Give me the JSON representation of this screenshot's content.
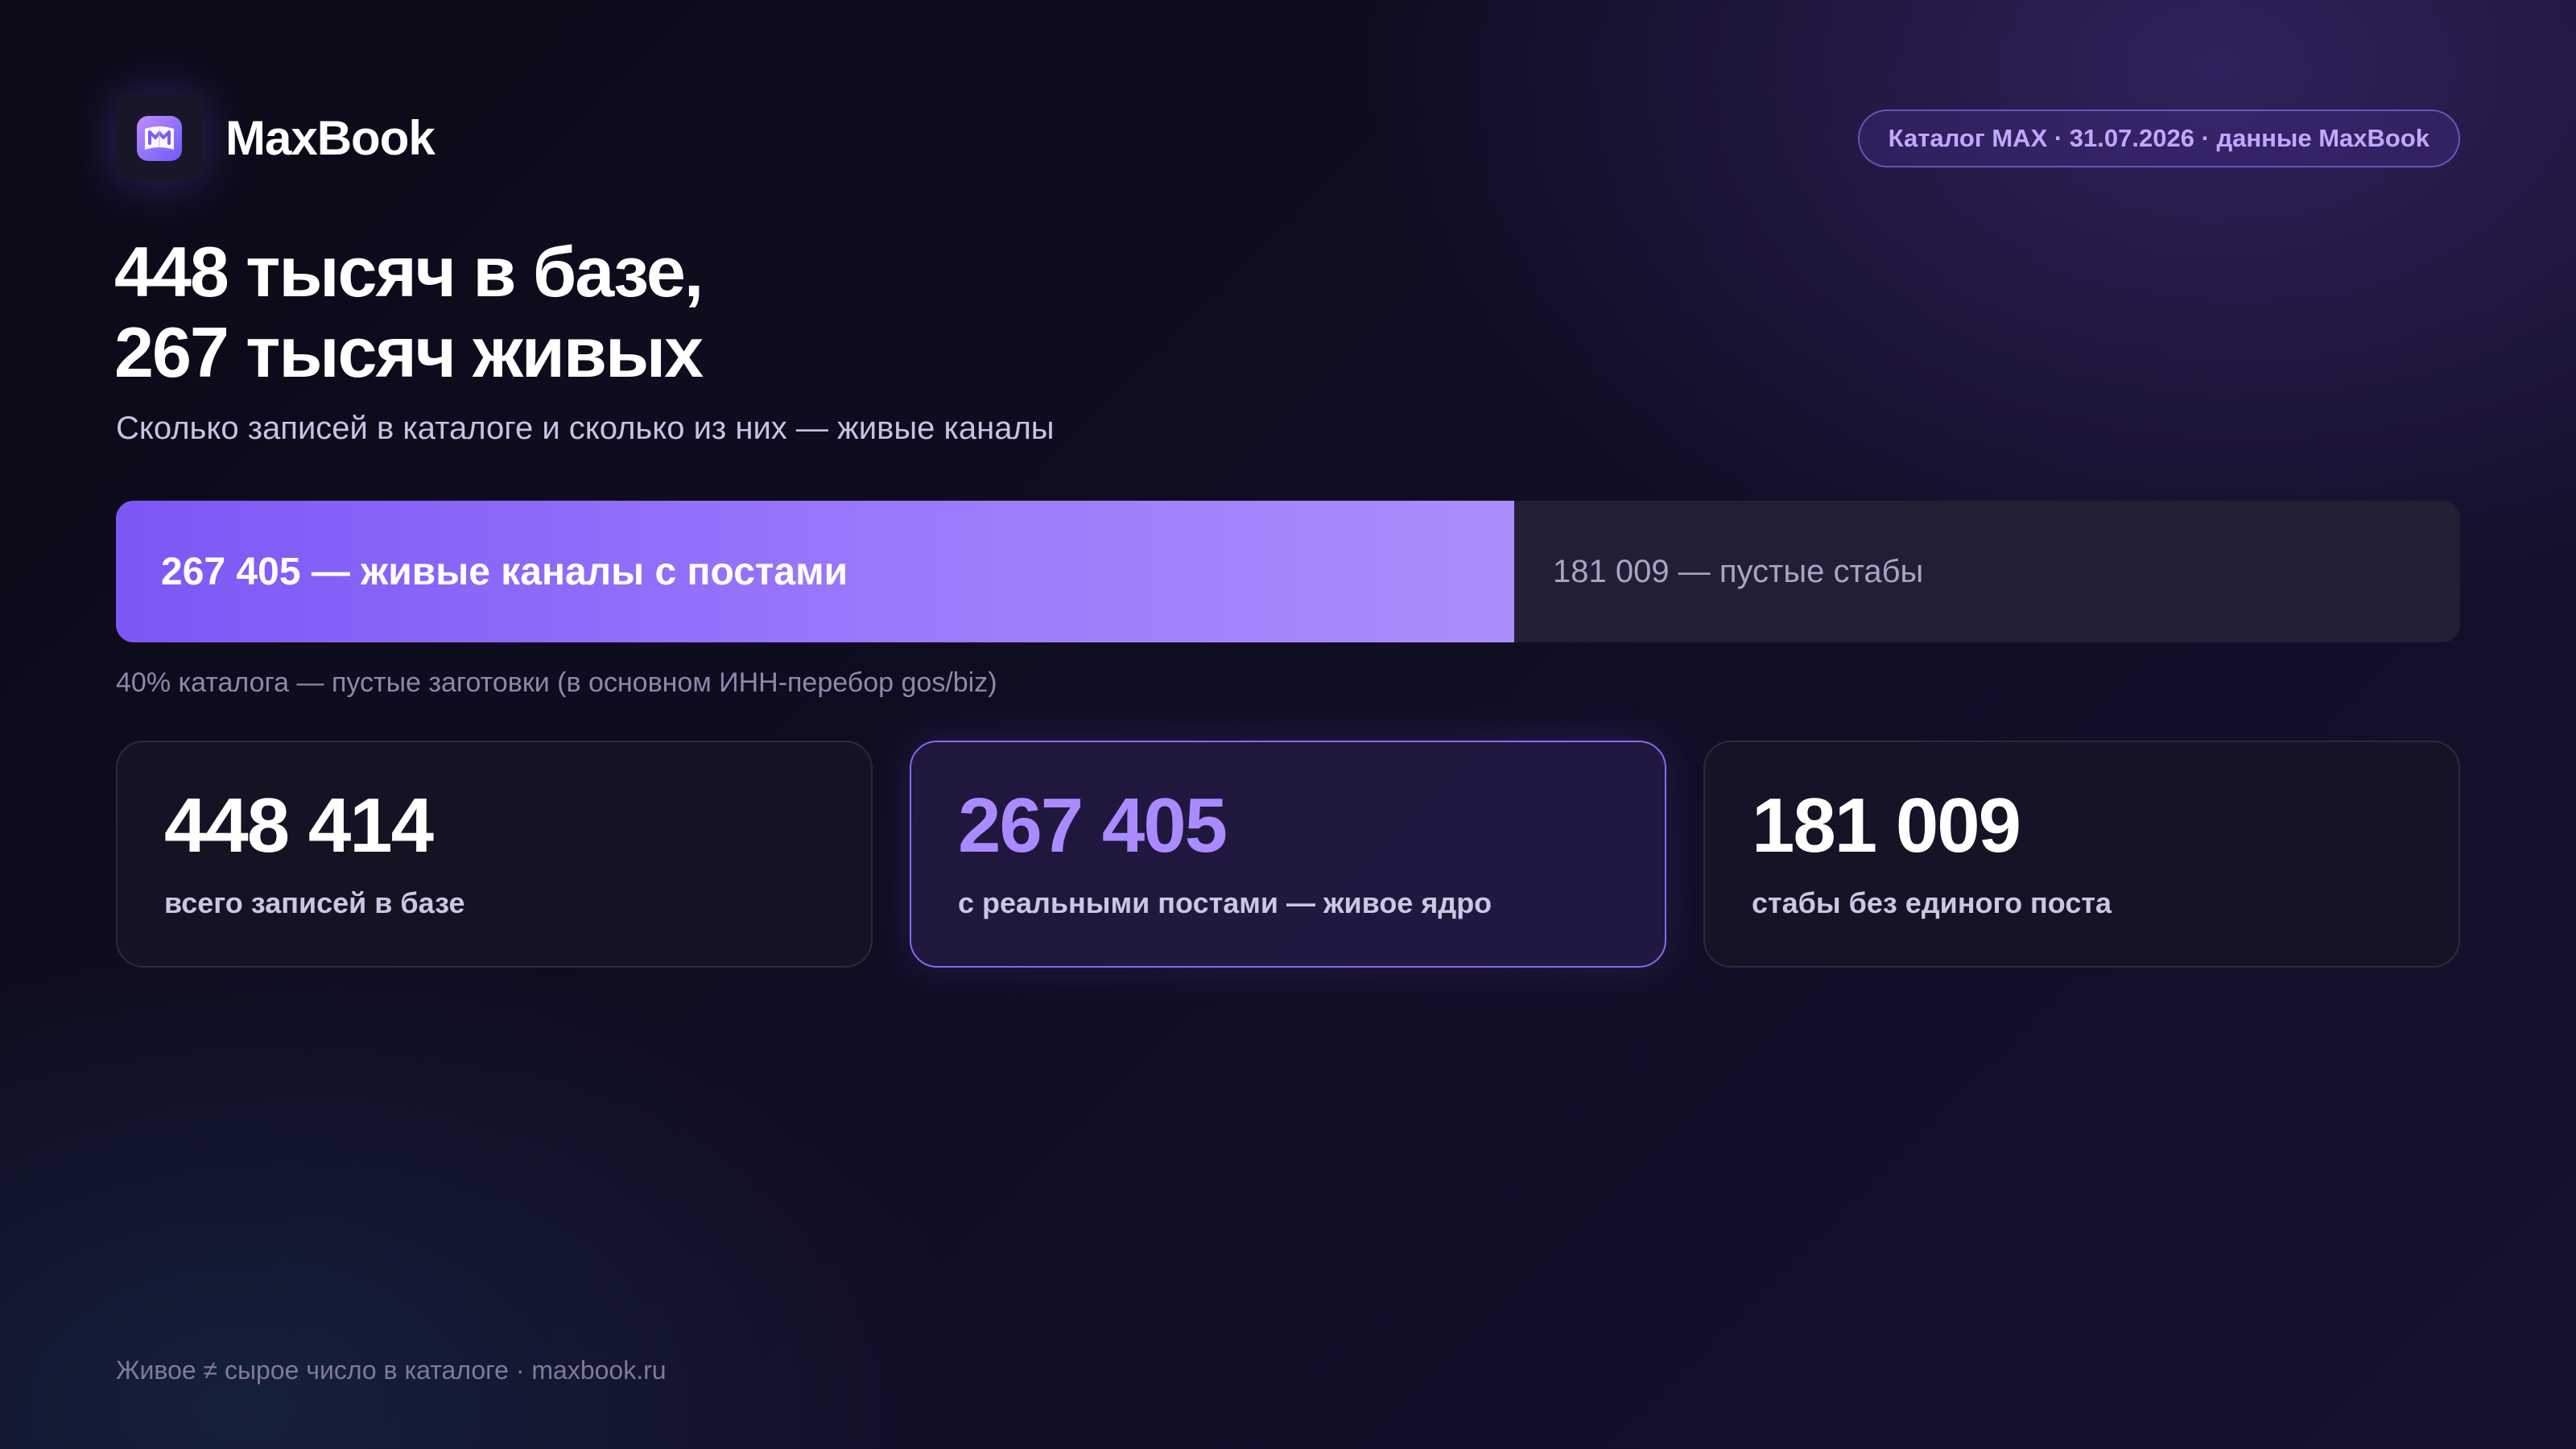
{
  "brand": {
    "name": "MaxBook",
    "icon": "maxbook-logo-icon",
    "accent_color": "#8b6cf6"
  },
  "badge": "Каталог MAX · 31.07.2026 · данные MaxBook",
  "headline": {
    "line1": "448 тысяч в базе,",
    "line2": "267 тысяч живых"
  },
  "subtitle": "Сколько записей в каталоге и сколько из них — живые каналы",
  "split_bar": {
    "total": 448414,
    "live": {
      "value": 267405,
      "label": "267 405 — живые каналы с постами",
      "color": "#8b6cf6"
    },
    "empty": {
      "value": 181009,
      "label": "181 009 — пустые стабы",
      "color": "#221e33"
    }
  },
  "note": "40% каталога — пустые заготовки (в основном ИНН-перебор gos/biz)",
  "stats": [
    {
      "value": "448 414",
      "label": "всего записей в базе",
      "highlight": false
    },
    {
      "value": "267 405",
      "label": "с реальными постами — живое ядро",
      "highlight": true
    },
    {
      "value": "181 009",
      "label": "стабы без единого поста",
      "highlight": false
    }
  ],
  "footer": "Живое ≠ сырое число в каталоге · maxbook.ru"
}
